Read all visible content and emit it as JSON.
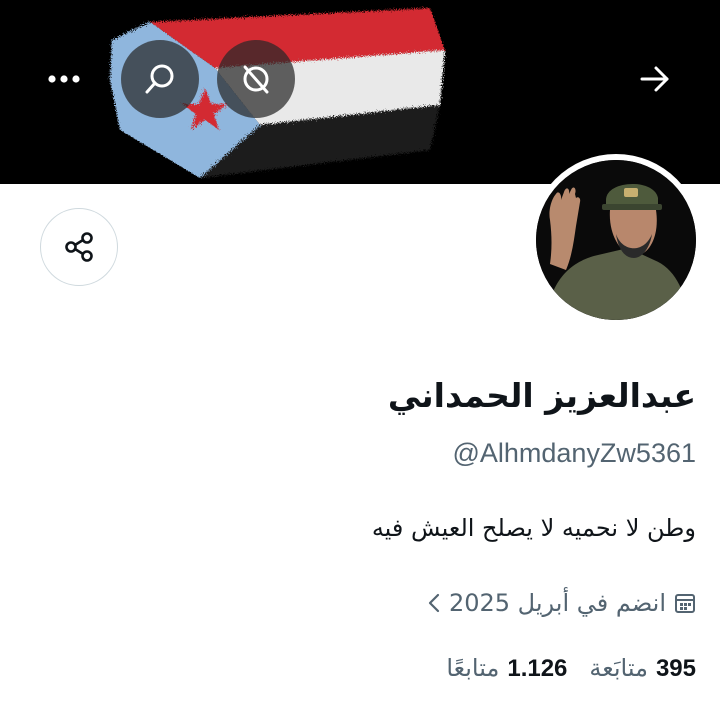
{
  "header": {
    "icons": [
      "more-icon",
      "search-icon",
      "grok-icon",
      "back-arrow-icon"
    ]
  },
  "profile": {
    "display_name": "عبدالعزيز الحمداني",
    "handle": "@AlhmdanyZw5361",
    "bio": "وطن لا نحميه لا يصلح العيش فيه",
    "joined": "انضم في أبريل 2025",
    "stats": {
      "following_count": "395",
      "following_label": "متابَعة",
      "followers_count": "1.126",
      "followers_label": "متابعًا"
    }
  },
  "colors": {
    "secondary_text": "#536471",
    "border": "#cfd9de",
    "flag_red": "#d32b30",
    "flag_blue": "#8fb6dd"
  }
}
